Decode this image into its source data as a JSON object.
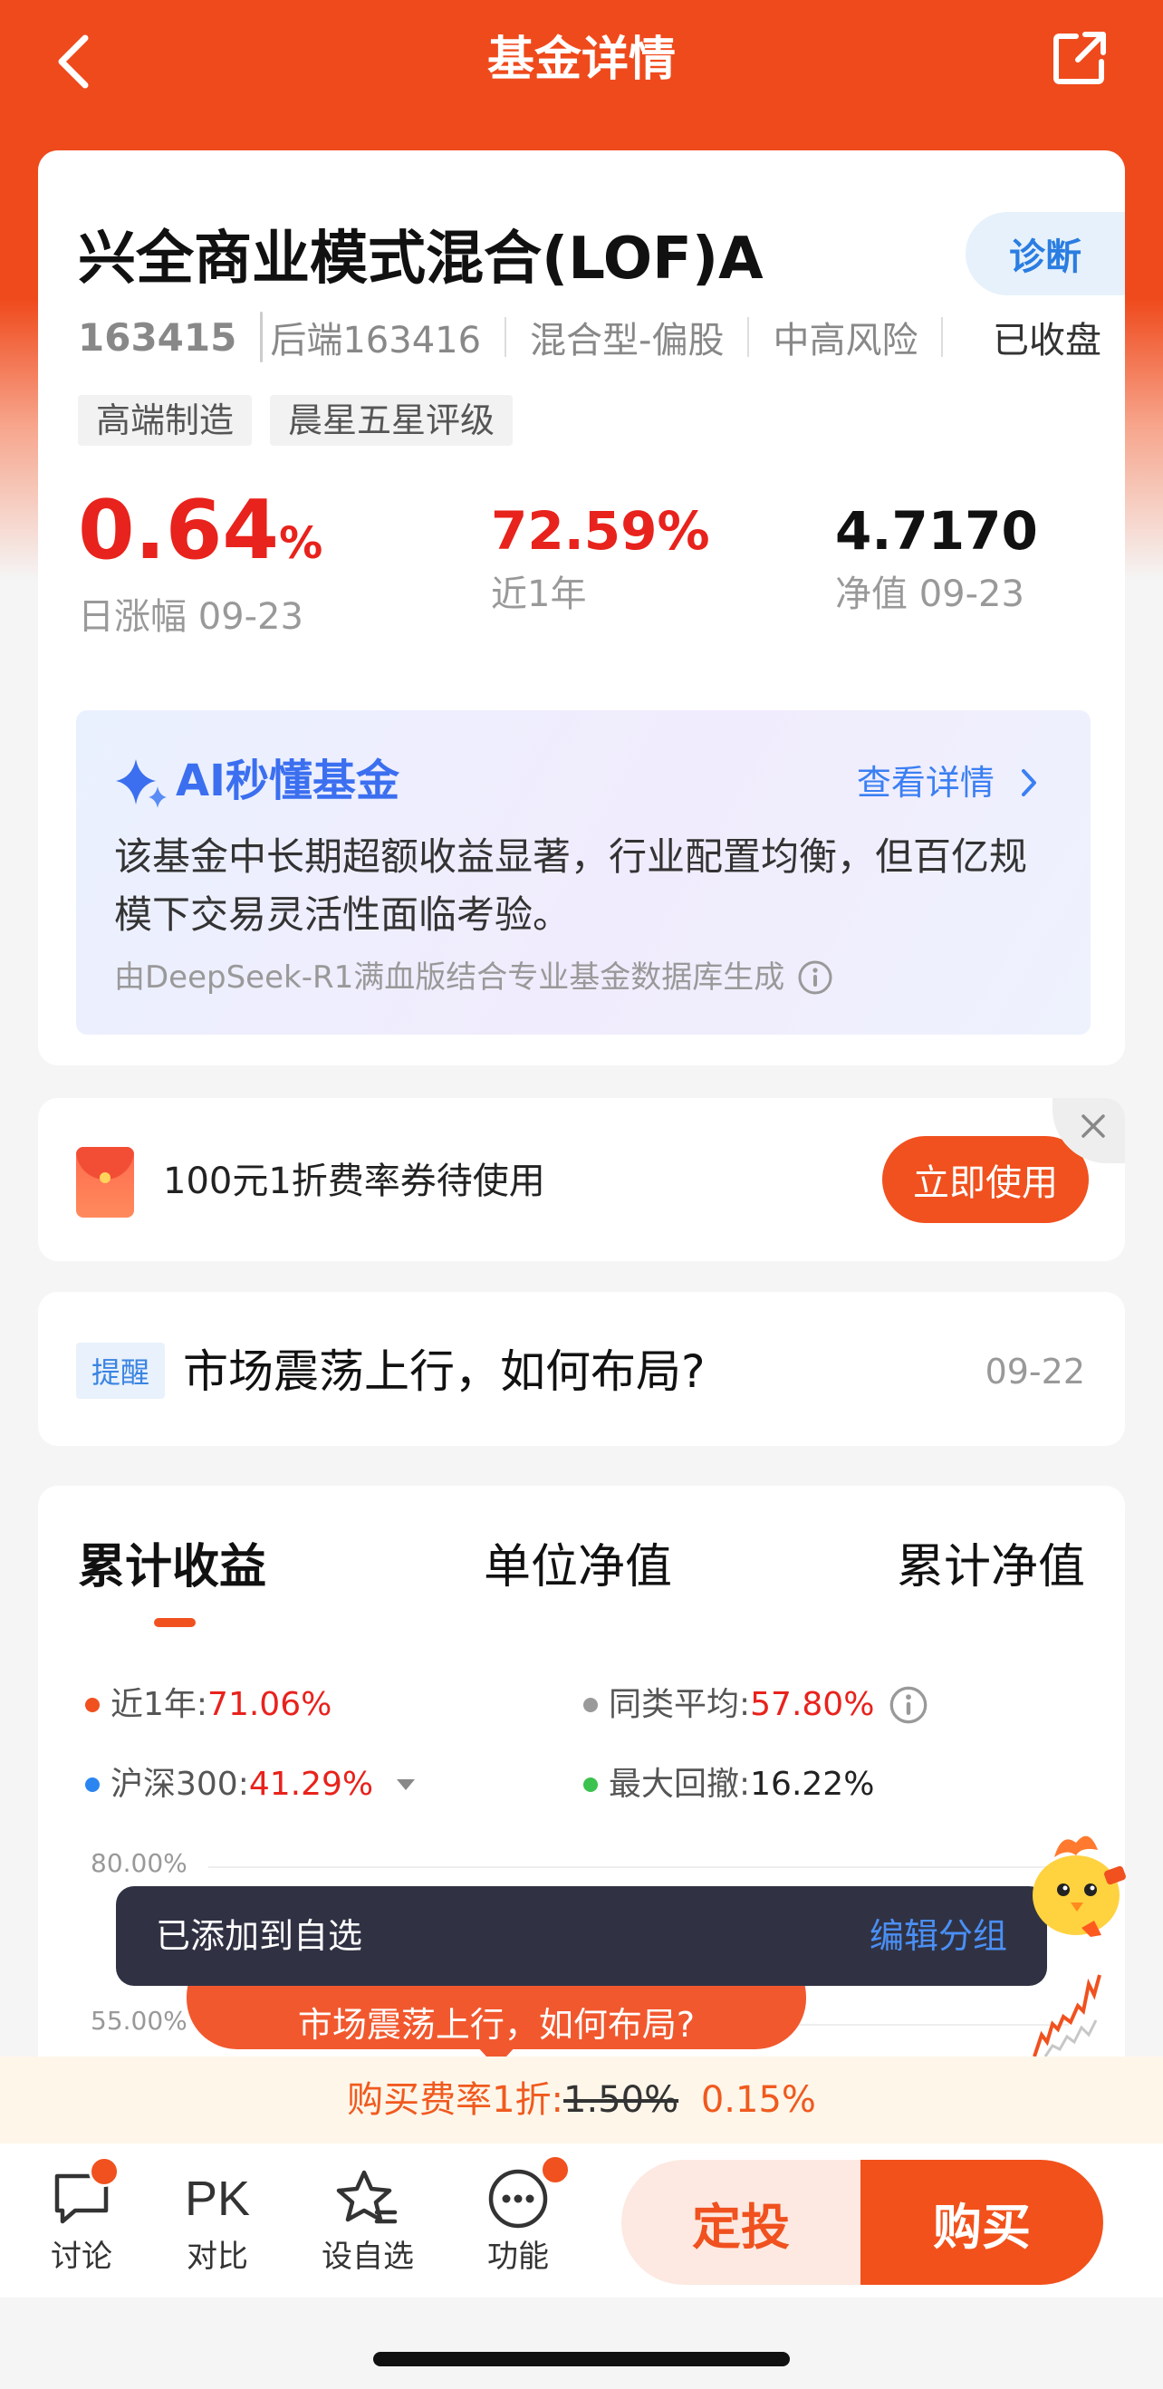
{
  "header": {
    "title": "基金详情",
    "back_icon": "chevron-left-icon",
    "share_icon": "share-out-icon"
  },
  "fund": {
    "name": "兴全商业模式混合(LOF)A",
    "diagnose_label": "诊断",
    "code": "163415",
    "backend_code": "后端163416",
    "type": "混合型-偏股",
    "risk": "中高风险",
    "status": "已收盘",
    "tags": [
      "高端制造",
      "晨星五星评级"
    ],
    "daily_change_value": "0.64",
    "daily_change_unit": "%",
    "daily_change_label": "日涨幅 09-23",
    "year_return_value": "72.59%",
    "year_return_label": "近1年",
    "nav_value": "4.7170",
    "nav_label": "净值 09-23"
  },
  "ai": {
    "title": "AI秒懂基金",
    "more_label": "查看详情",
    "summary": "该基金中长期超额收益显著，行业配置均衡，但百亿规模下交易灵活性面临考验。",
    "source": "由DeepSeek-R1满血版结合专业基金数据库生成"
  },
  "coupon": {
    "text": "100元1折费率券待使用",
    "button_label": "立即使用"
  },
  "reminder": {
    "badge": "提醒",
    "text": "市场震荡上行，如何布局?",
    "date": "09-22"
  },
  "chart": {
    "tabs": [
      "累计收益",
      "单位净值",
      "累计净值"
    ],
    "active_tab": 0,
    "legend": {
      "near_year_label": "近1年:",
      "near_year_value": "71.06%",
      "peer_avg_label": "同类平均:",
      "peer_avg_value": "57.80%",
      "hs300_label": "沪深300:",
      "hs300_value": "41.29%",
      "max_drawdown_label": "最大回撤:",
      "max_drawdown_value": "16.22%"
    },
    "y_labels": [
      "80.00%",
      "55.00%"
    ],
    "colors": {
      "fund": "#f0511e",
      "peer": "#9a9a9a",
      "hs300": "#2a85f0",
      "drawdown": "#3cc24f"
    }
  },
  "toast": {
    "text": "已添加到自选",
    "link": "编辑分组"
  },
  "bubble": {
    "text": "市场震荡上行，如何布局?"
  },
  "fee": {
    "label": "购买费率1折:",
    "old_rate": "1.50%",
    "new_rate": "0.15%"
  },
  "bottom": {
    "discuss_label": "讨论",
    "compare_icon_text": "PK",
    "compare_label": "对比",
    "watch_label": "设自选",
    "more_label": "功能",
    "dingtou_label": "定投",
    "buy_label": "购买"
  }
}
